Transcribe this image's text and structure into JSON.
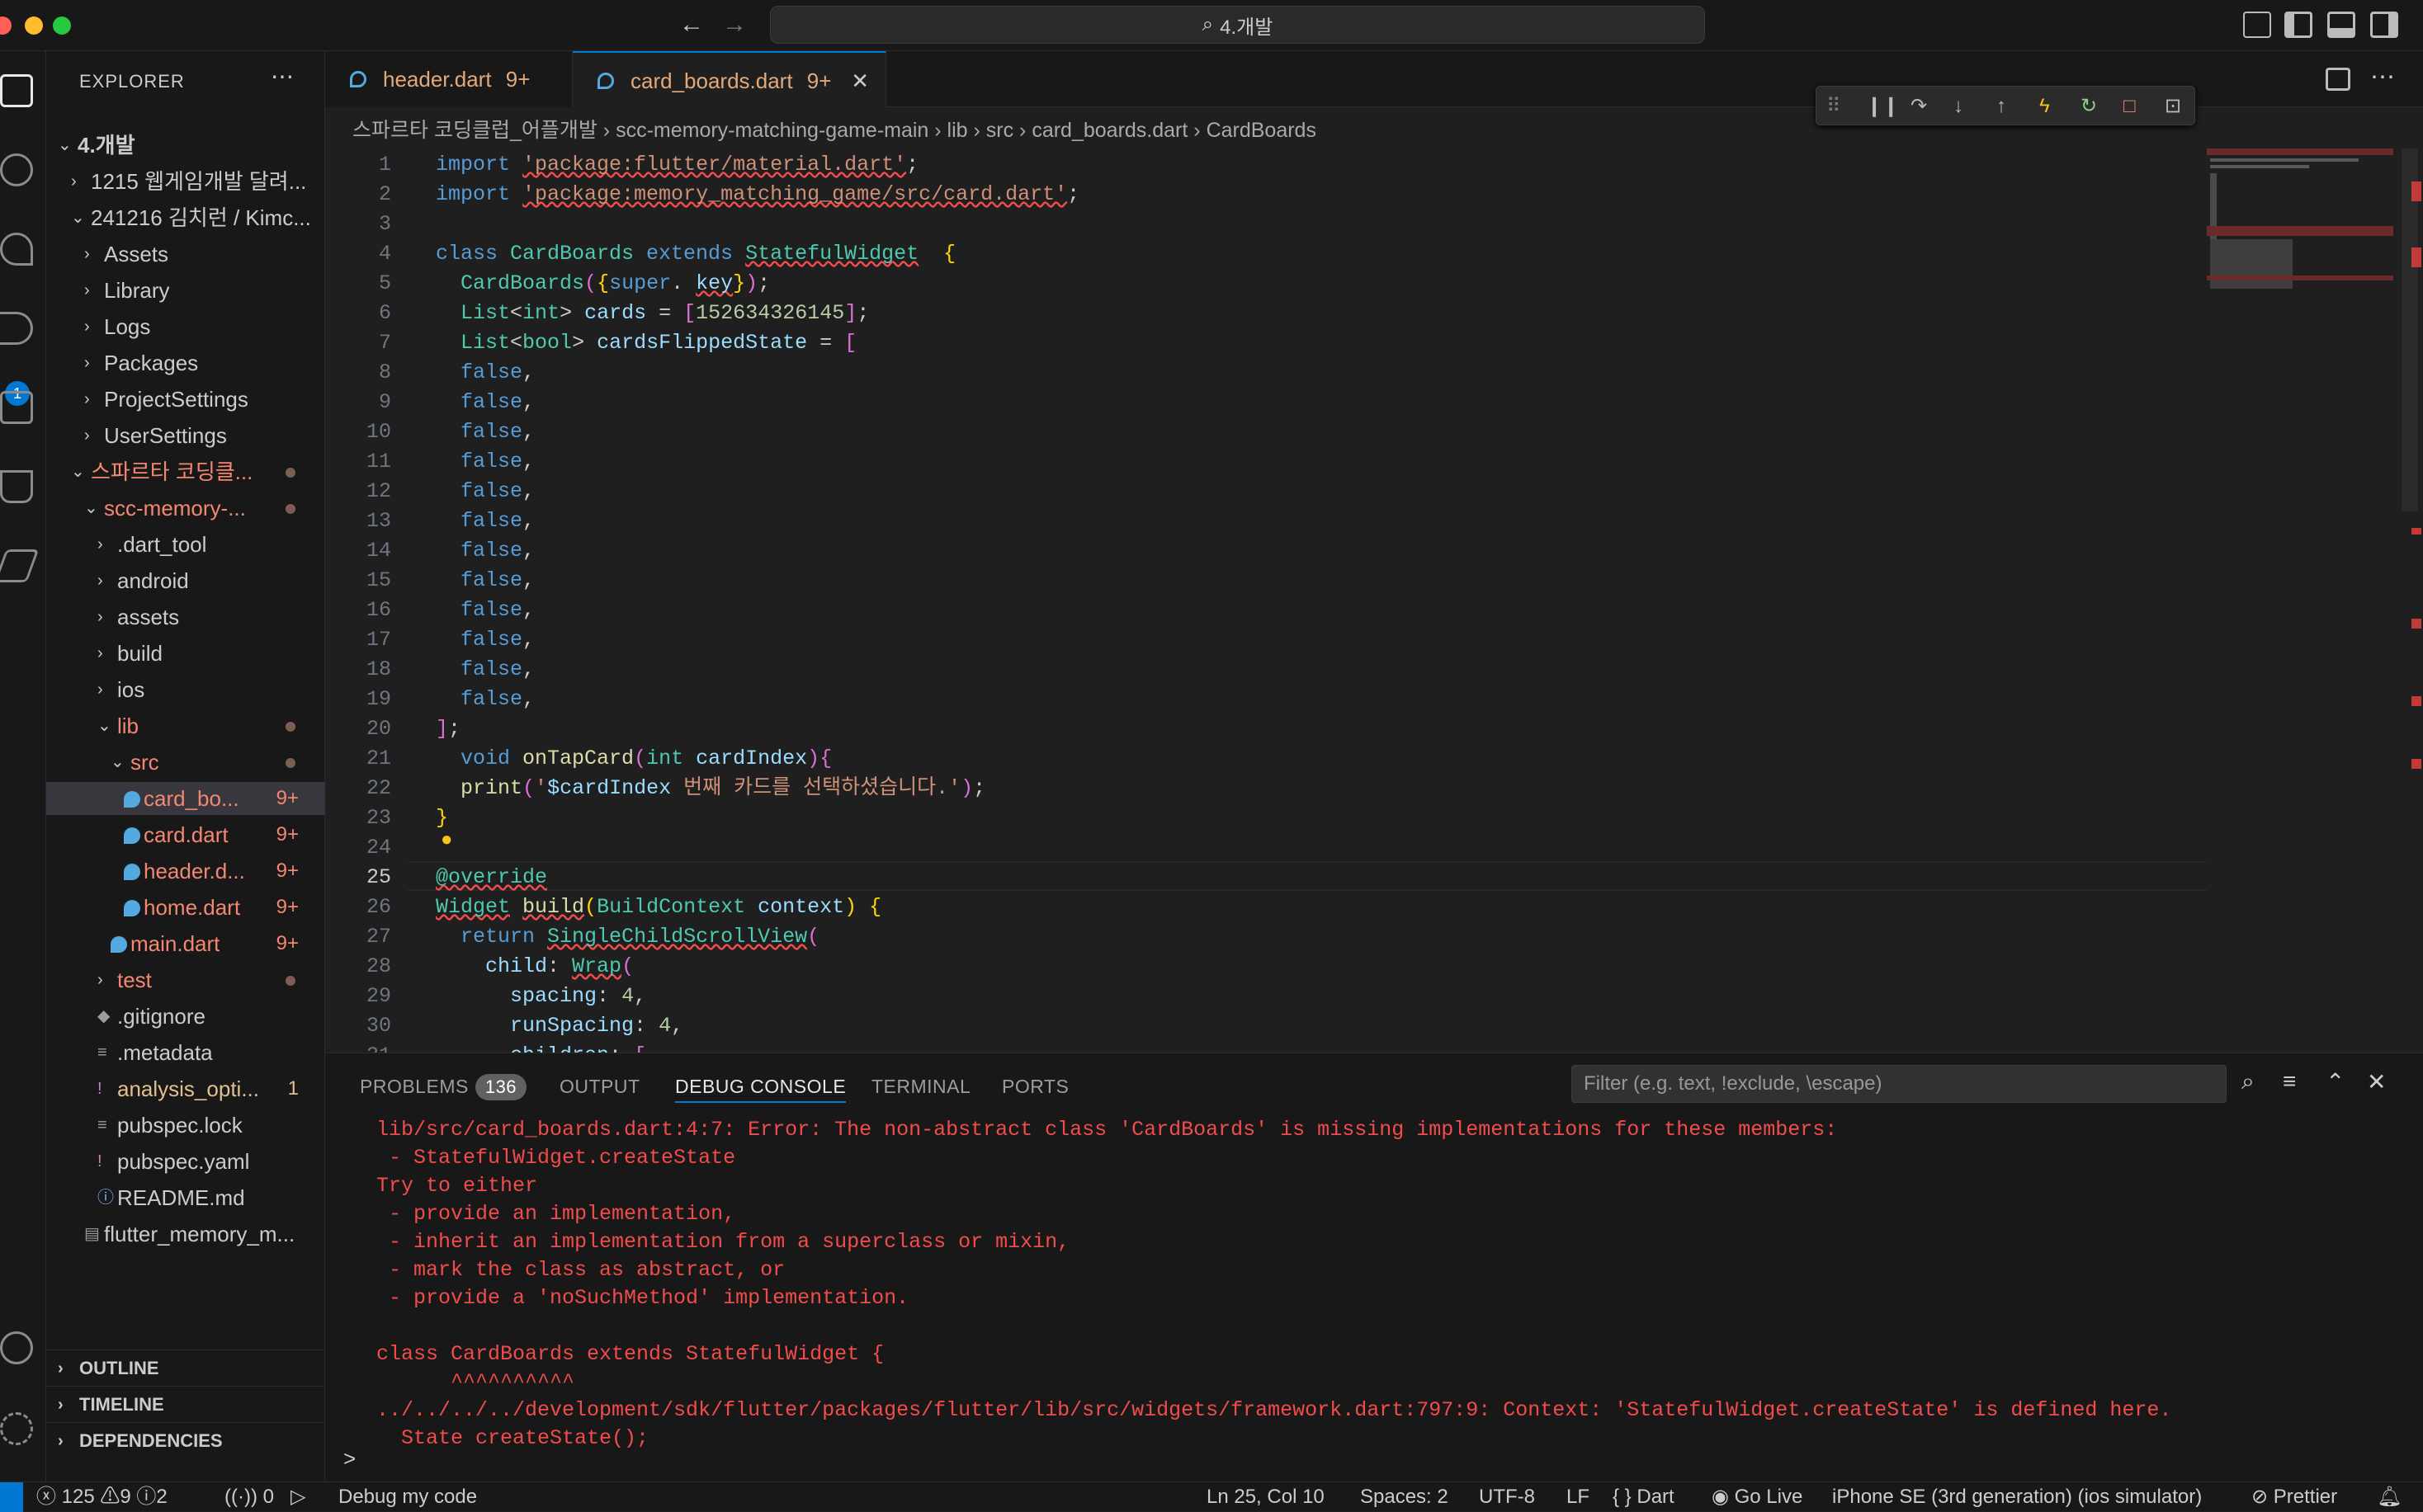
{
  "title": "4.개발",
  "sidebar": {
    "title": "EXPLORER",
    "tree": [
      {
        "label": "4.개발",
        "depth": 0,
        "open": true,
        "bold": true
      },
      {
        "label": "1215 웹게임개발 달려...",
        "depth": 1,
        "open": false
      },
      {
        "label": "241216 김치런 / Kimc...",
        "depth": 1,
        "open": true
      },
      {
        "label": "Assets",
        "depth": 2,
        "open": false
      },
      {
        "label": "Library",
        "depth": 2,
        "open": false
      },
      {
        "label": "Logs",
        "depth": 2,
        "open": false
      },
      {
        "label": "Packages",
        "depth": 2,
        "open": false
      },
      {
        "label": "ProjectSettings",
        "depth": 2,
        "open": false
      },
      {
        "label": "UserSettings",
        "depth": 2,
        "open": false
      },
      {
        "label": "스파르타 코딩클...",
        "depth": 1,
        "open": true,
        "color": "err",
        "dot": true
      },
      {
        "label": "scc-memory-...",
        "depth": 2,
        "open": true,
        "color": "err",
        "dot": true
      },
      {
        "label": ".dart_tool",
        "depth": 3,
        "open": false
      },
      {
        "label": "android",
        "depth": 3,
        "open": false
      },
      {
        "label": "assets",
        "depth": 3,
        "open": false
      },
      {
        "label": "build",
        "depth": 3,
        "open": false
      },
      {
        "label": "ios",
        "depth": 3,
        "open": false
      },
      {
        "label": "lib",
        "depth": 3,
        "open": true,
        "color": "err",
        "dot": true
      },
      {
        "label": "src",
        "depth": 4,
        "open": true,
        "color": "err",
        "dot": true
      },
      {
        "label": "card_bo...",
        "depth": 5,
        "file": "dart",
        "color": "err",
        "badge": "9+",
        "selected": true
      },
      {
        "label": "card.dart",
        "depth": 5,
        "file": "dart",
        "color": "err",
        "badge": "9+"
      },
      {
        "label": "header.d...",
        "depth": 5,
        "file": "dart",
        "color": "err",
        "badge": "9+"
      },
      {
        "label": "home.dart",
        "depth": 5,
        "file": "dart",
        "color": "err",
        "badge": "9+"
      },
      {
        "label": "main.dart",
        "depth": 4,
        "file": "dart",
        "color": "err",
        "badge": "9+"
      },
      {
        "label": "test",
        "depth": 3,
        "open": false,
        "color": "err",
        "dot": true
      },
      {
        "label": ".gitignore",
        "depth": 3,
        "file": "git"
      },
      {
        "label": ".metadata",
        "depth": 3,
        "file": "lines"
      },
      {
        "label": "analysis_opti...",
        "depth": 3,
        "file": "bang",
        "color": "mod",
        "badge": "1"
      },
      {
        "label": "pubspec.lock",
        "depth": 3,
        "file": "lines"
      },
      {
        "label": "pubspec.yaml",
        "depth": 3,
        "file": "bang"
      },
      {
        "label": "README.md",
        "depth": 3,
        "file": "info"
      },
      {
        "label": "flutter_memory_m...",
        "depth": 2,
        "file": "doc"
      }
    ],
    "sections": [
      "OUTLINE",
      "TIMELINE",
      "DEPENDENCIES"
    ]
  },
  "tabs": [
    {
      "label": "header.dart",
      "badge": "9+"
    },
    {
      "label": "card_boards.dart",
      "badge": "9+",
      "active": true
    }
  ],
  "breadcrumb": [
    "스파르타 코딩클럽_어플개발",
    "scc-memory-matching-game-main",
    "lib",
    "src",
    "card_boards.dart",
    "CardBoards"
  ],
  "editor": {
    "current_line": 25,
    "lines": [
      [
        [
          "kw",
          "import "
        ],
        [
          "st sq",
          "'package:flutter/material.dart'"
        ],
        [
          "",
          "; "
        ]
      ],
      [
        [
          "kw",
          "import "
        ],
        [
          "st sq",
          "'package:memory_matching_game/src/card.dart'"
        ],
        [
          "",
          ";"
        ]
      ],
      [],
      [
        [
          "kw",
          "class "
        ],
        [
          "ty",
          "CardBoards "
        ],
        [
          "kw",
          "extends "
        ],
        [
          "ty sq",
          "StatefulWidget"
        ],
        [
          "",
          "  "
        ],
        [
          "pn",
          "{"
        ]
      ],
      [
        [
          "",
          "  "
        ],
        [
          "ty",
          "CardBoards"
        ],
        [
          "pu",
          "("
        ],
        [
          "pn",
          "{"
        ],
        [
          "kw",
          "super"
        ],
        [
          "",
          ". "
        ],
        [
          "vr sq",
          "key"
        ],
        [
          "pn",
          "}"
        ],
        [
          "pu",
          ")"
        ],
        [
          "",
          ";"
        ]
      ],
      [
        [
          "",
          "  "
        ],
        [
          "ty",
          "List"
        ],
        [
          "",
          "<"
        ],
        [
          "ty",
          "int"
        ],
        [
          "",
          "> "
        ],
        [
          "vr",
          "cards"
        ],
        [
          "",
          " = "
        ],
        [
          "pu",
          "["
        ],
        [
          "nm",
          "1"
        ],
        [
          ",  "
        ],
        [
          "nm",
          "5"
        ],
        [
          ",  "
        ],
        [
          "nm",
          "2"
        ],
        [
          ",  "
        ],
        [
          "nm",
          "6"
        ],
        [
          ",  "
        ],
        [
          "nm",
          "3"
        ],
        [
          ",  "
        ],
        [
          "nm",
          "4"
        ],
        [
          ",  "
        ],
        [
          "nm",
          "3"
        ],
        [
          ",  "
        ],
        [
          "nm",
          "2"
        ],
        [
          ",  "
        ],
        [
          "nm",
          "6"
        ],
        [
          ",  "
        ],
        [
          "nm",
          "1"
        ],
        [
          ",  "
        ],
        [
          "nm",
          "4"
        ],
        [
          ",  "
        ],
        [
          "nm",
          "5"
        ],
        [
          "pu",
          "]"
        ],
        [
          "",
          ";"
        ]
      ],
      [
        [
          "",
          "  "
        ],
        [
          "ty",
          "List"
        ],
        [
          "",
          "<"
        ],
        [
          "ty",
          "bool"
        ],
        [
          "",
          "> "
        ],
        [
          "vr",
          "cardsFlippedState"
        ],
        [
          "",
          " = "
        ],
        [
          "pu",
          "["
        ]
      ],
      [
        [
          "",
          "  "
        ],
        [
          "kw",
          "false"
        ],
        [
          "",
          ","
        ]
      ],
      [
        [
          "",
          "  "
        ],
        [
          "kw",
          "false"
        ],
        [
          "",
          ","
        ]
      ],
      [
        [
          "",
          "  "
        ],
        [
          "kw",
          "false"
        ],
        [
          "",
          ","
        ]
      ],
      [
        [
          "",
          "  "
        ],
        [
          "kw",
          "false"
        ],
        [
          "",
          ","
        ]
      ],
      [
        [
          "",
          "  "
        ],
        [
          "kw",
          "false"
        ],
        [
          "",
          ","
        ]
      ],
      [
        [
          "",
          "  "
        ],
        [
          "kw",
          "false"
        ],
        [
          "",
          ","
        ]
      ],
      [
        [
          "",
          "  "
        ],
        [
          "kw",
          "false"
        ],
        [
          "",
          ","
        ]
      ],
      [
        [
          "",
          "  "
        ],
        [
          "kw",
          "false"
        ],
        [
          "",
          ","
        ]
      ],
      [
        [
          "",
          "  "
        ],
        [
          "kw",
          "false"
        ],
        [
          "",
          ","
        ]
      ],
      [
        [
          "",
          "  "
        ],
        [
          "kw",
          "false"
        ],
        [
          "",
          ","
        ]
      ],
      [
        [
          "",
          "  "
        ],
        [
          "kw",
          "false"
        ],
        [
          "",
          ","
        ]
      ],
      [
        [
          "",
          "  "
        ],
        [
          "kw",
          "false"
        ],
        [
          "",
          ","
        ]
      ],
      [
        [
          "pu",
          "]"
        ],
        [
          "",
          ";"
        ]
      ],
      [
        [
          "",
          "  "
        ],
        [
          "kw",
          "void "
        ],
        [
          "fn",
          "onTapCard"
        ],
        [
          "pu",
          "("
        ],
        [
          "ty",
          "int "
        ],
        [
          "vr",
          "cardIndex"
        ],
        [
          "pu",
          ")"
        ],
        [
          "pu",
          "{"
        ]
      ],
      [
        [
          "",
          "  "
        ],
        [
          "fn",
          "print"
        ],
        [
          "pu",
          "("
        ],
        [
          "st",
          "'"
        ],
        [
          "vr",
          "$cardIndex"
        ],
        [
          "st",
          " 번째 카드를 선택하셨습니다.'"
        ],
        [
          "pu",
          ")"
        ],
        [
          "",
          ";"
        ]
      ],
      [
        [
          "pn",
          "}"
        ]
      ],
      [],
      [
        [
          "ty sq",
          "@override"
        ]
      ],
      [
        [
          "ty sq",
          "Widget"
        ],
        [
          "",
          " "
        ],
        [
          "fn sq",
          "build"
        ],
        [
          "pn",
          "("
        ],
        [
          "ty",
          "BuildContext "
        ],
        [
          "vr",
          "context"
        ],
        [
          "pn",
          ")"
        ],
        [
          "",
          " "
        ],
        [
          "pn",
          "{"
        ]
      ],
      [
        [
          "",
          "  "
        ],
        [
          "kw",
          "return "
        ],
        [
          "ty sq",
          "SingleChildScrollView"
        ],
        [
          "pu",
          "("
        ]
      ],
      [
        [
          "",
          "    "
        ],
        [
          "vr",
          "child"
        ],
        [
          "",
          ": "
        ],
        [
          "ty sq",
          "Wrap"
        ],
        [
          "pu",
          "("
        ]
      ],
      [
        [
          "",
          "      "
        ],
        [
          "vr",
          "spacing"
        ],
        [
          "",
          ": "
        ],
        [
          "nm",
          "4"
        ],
        [
          "",
          ","
        ]
      ],
      [
        [
          "",
          "      "
        ],
        [
          "vr",
          "runSpacing"
        ],
        [
          "",
          ": "
        ],
        [
          "nm",
          "4"
        ],
        [
          "",
          ","
        ]
      ],
      [
        [
          "",
          "      "
        ],
        [
          "vr",
          "children"
        ],
        [
          "",
          ": "
        ],
        [
          "pu",
          "["
        ]
      ]
    ]
  },
  "panel": {
    "tabs": [
      "PROBLEMS",
      "OUTPUT",
      "DEBUG CONSOLE",
      "TERMINAL",
      "PORTS"
    ],
    "problems_count": "136",
    "active_tab": "DEBUG CONSOLE",
    "filter_placeholder": "Filter (e.g. text, !exclude, \\escape)",
    "console_lines": [
      "lib/src/card_boards.dart:4:7: Error: The non-abstract class 'CardBoards' is missing implementations for these members:",
      " - StatefulWidget.createState",
      "Try to either",
      " - provide an implementation,",
      " - inherit an implementation from a superclass or mixin,",
      " - mark the class as abstract, or",
      " - provide a 'noSuchMethod' implementation.",
      "",
      "class CardBoards extends StatefulWidget {",
      "      ^^^^^^^^^^",
      "../../../../development/sdk/flutter/packages/flutter/lib/src/widgets/framework.dart:797:9: Context: 'StatefulWidget.createState' is defined here.",
      "  State createState();"
    ],
    "prompt": ">"
  },
  "statusbar": {
    "errors": "125",
    "warnings": "9",
    "infos": "2",
    "ports": "0",
    "launch": "Debug my code",
    "position": "Ln 25, Col 10",
    "spaces": "Spaces: 2",
    "encoding": "UTF-8",
    "eol": "LF",
    "language": "Dart",
    "golive": "Go Live",
    "device": "iPhone SE (3rd generation) (ios simulator)",
    "prettier": "Prettier"
  },
  "activity_badge": "1",
  "colors": {
    "accent": "#0078d4",
    "error": "#f14c4c",
    "modified": "#e2c08d"
  }
}
